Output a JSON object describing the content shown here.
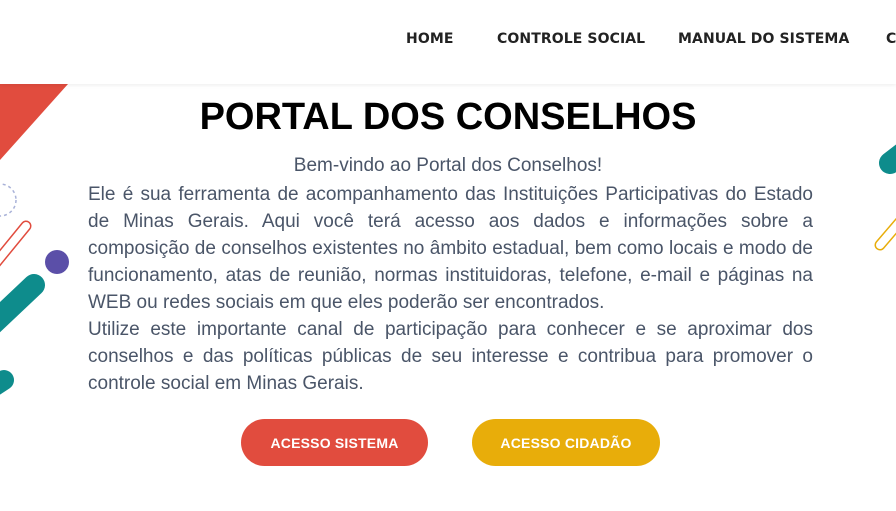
{
  "nav": {
    "items": [
      {
        "label": "HOME"
      },
      {
        "label": "CONTROLE SOCIAL"
      },
      {
        "label": "MANUAL DO SISTEMA"
      },
      {
        "label": "C"
      }
    ]
  },
  "main": {
    "title": "PORTAL DOS CONSELHOS",
    "welcome": "Bem-vindo ao Portal dos Conselhos!",
    "paragraph_1": "Ele é sua ferramenta de acompanhamento das Instituições Participativas do Estado de Minas Gerais. Aqui você terá acesso aos dados e informações sobre a composição de conselhos existentes no âmbito estadual, bem como locais e modo de funcionamento, atas de reunião, normas instituidoras, telefone, e-mail e páginas na WEB ou redes sociais em que eles poderão ser encontrados.",
    "paragraph_2": "Utilize este importante canal de participação para conhecer e se aproximar dos conselhos e das políticas públicas de seu interesse e contribua para promover o controle social em Minas Gerais."
  },
  "buttons": {
    "sistema_label": "ACESSO SISTEMA",
    "cidadao_label": "ACESSO CIDADÃO"
  },
  "colors": {
    "red": "#e14c3e",
    "yellow": "#e8ad0a",
    "teal": "#0e8c8c",
    "purple": "#5b4fa8",
    "text": "#4a5568"
  }
}
